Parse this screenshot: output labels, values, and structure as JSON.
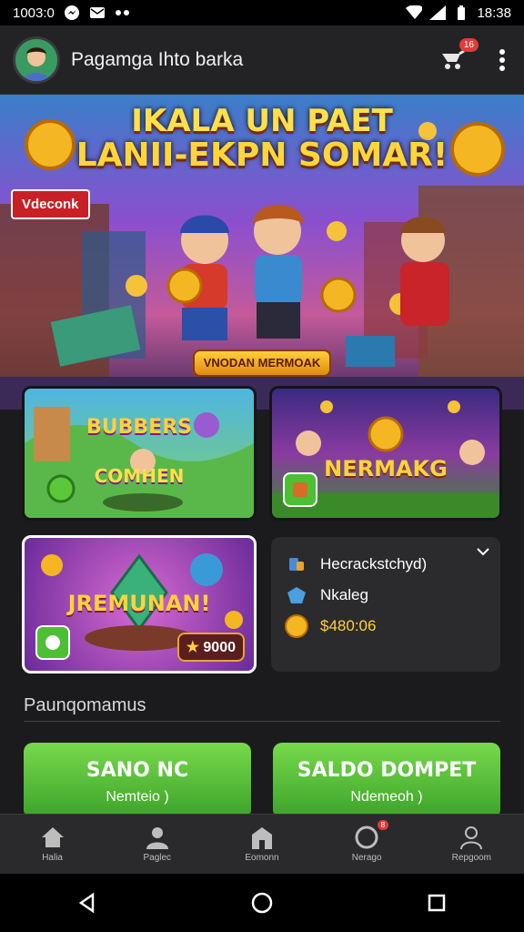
{
  "status": {
    "left_text": "1003:0",
    "time": "18:38"
  },
  "header": {
    "title": "Pagamga Ihto barka",
    "notif_count": "16"
  },
  "banner": {
    "title_line1": "IKALA UN PAET",
    "title_line2": "LANII-EKPN SOMAR!",
    "tag": "Vdeconk",
    "button": "VNODAN MERMOAK"
  },
  "cards": [
    {
      "name": "game-card-boonbers",
      "label_top": "BUBBERS",
      "label_bottom": "COMHEN"
    },
    {
      "name": "game-card-nermakc",
      "label": "NERMAKG"
    },
    {
      "name": "game-card-jremunan",
      "label": "JREMUNAN!",
      "price": "9000"
    }
  ],
  "info": {
    "rows": [
      {
        "label": "Hecrackstchyd)"
      },
      {
        "label": "Nkaleg"
      },
      {
        "label": "$480:06"
      }
    ]
  },
  "section_title": "Paunqomamus",
  "buttons": [
    {
      "title": "SANO NC",
      "sub": "Nemteio )"
    },
    {
      "title": "SALDO DOMPET",
      "sub": "Ndemeoh )"
    }
  ],
  "nav": [
    {
      "label": "Halia"
    },
    {
      "label": "Paglec"
    },
    {
      "label": "Eomonn"
    },
    {
      "label": "Nerago",
      "badge": "8"
    },
    {
      "label": "Repgoom"
    }
  ],
  "colors": {
    "accent_green": "#4cbf35",
    "badge_red": "#e23b3b",
    "gold": "#ffd63a"
  }
}
